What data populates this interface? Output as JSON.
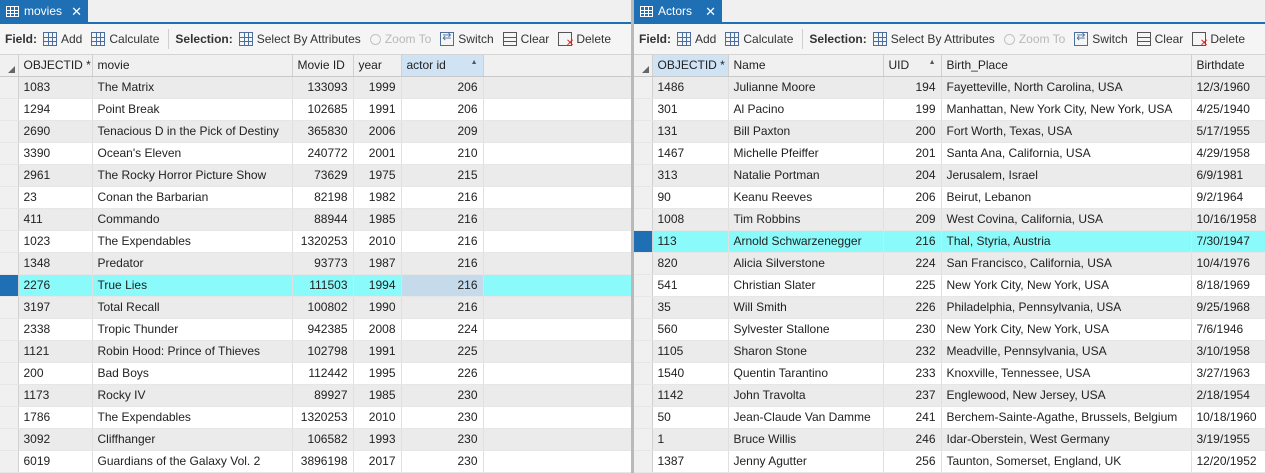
{
  "left": {
    "tab_title": "movies",
    "toolbar": {
      "field_label": "Field:",
      "add": "Add",
      "calculate": "Calculate",
      "selection_label": "Selection:",
      "select_by_attributes": "Select By Attributes",
      "zoom_to": "Zoom To",
      "switch": "Switch",
      "clear": "Clear",
      "delete": "Delete"
    },
    "columns": [
      "OBJECTID *",
      "movie",
      "Movie ID",
      "year",
      "actor id"
    ],
    "rows": [
      [
        "1083",
        "The Matrix",
        "133093",
        "1999",
        "206"
      ],
      [
        "1294",
        "Point Break",
        "102685",
        "1991",
        "206"
      ],
      [
        "2690",
        "Tenacious D in the Pick of Destiny",
        "365830",
        "2006",
        "209"
      ],
      [
        "3390",
        "Ocean's Eleven",
        "240772",
        "2001",
        "210"
      ],
      [
        "2961",
        "The Rocky Horror Picture Show",
        "73629",
        "1975",
        "215"
      ],
      [
        "23",
        "Conan the Barbarian",
        "82198",
        "1982",
        "216"
      ],
      [
        "411",
        "Commando",
        "88944",
        "1985",
        "216"
      ],
      [
        "1023",
        "The Expendables",
        "1320253",
        "2010",
        "216"
      ],
      [
        "1348",
        "Predator",
        "93773",
        "1987",
        "216"
      ],
      [
        "2276",
        "True Lies",
        "111503",
        "1994",
        "216"
      ],
      [
        "3197",
        "Total Recall",
        "100802",
        "1990",
        "216"
      ],
      [
        "2338",
        "Tropic Thunder",
        "942385",
        "2008",
        "224"
      ],
      [
        "1121",
        "Robin Hood: Prince of Thieves",
        "102798",
        "1991",
        "225"
      ],
      [
        "200",
        "Bad Boys",
        "112442",
        "1995",
        "226"
      ],
      [
        "1173",
        "Rocky IV",
        "89927",
        "1985",
        "230"
      ],
      [
        "1786",
        "The Expendables",
        "1320253",
        "2010",
        "230"
      ],
      [
        "3092",
        "Cliffhanger",
        "106582",
        "1993",
        "230"
      ],
      [
        "6019",
        "Guardians of the Galaxy Vol. 2",
        "3896198",
        "2017",
        "230"
      ]
    ]
  },
  "right": {
    "tab_title": "Actors",
    "toolbar": {
      "field_label": "Field:",
      "add": "Add",
      "calculate": "Calculate",
      "selection_label": "Selection:",
      "select_by_attributes": "Select By Attributes",
      "zoom_to": "Zoom To",
      "switch": "Switch",
      "clear": "Clear",
      "delete": "Delete"
    },
    "columns": [
      "OBJECTID *",
      "Name",
      "UID",
      "Birth_Place",
      "Birthdate"
    ],
    "rows": [
      [
        "1486",
        "Julianne Moore",
        "194",
        "Fayetteville, North Carolina, USA",
        "12/3/1960"
      ],
      [
        "301",
        "Al Pacino",
        "199",
        "Manhattan, New York City, New York, USA",
        "4/25/1940"
      ],
      [
        "131",
        "Bill Paxton",
        "200",
        "Fort Worth, Texas, USA",
        "5/17/1955"
      ],
      [
        "1467",
        "Michelle Pfeiffer",
        "201",
        "Santa Ana, California, USA",
        "4/29/1958"
      ],
      [
        "313",
        "Natalie Portman",
        "204",
        "Jerusalem, Israel",
        "6/9/1981"
      ],
      [
        "90",
        "Keanu Reeves",
        "206",
        "Beirut, Lebanon",
        "9/2/1964"
      ],
      [
        "1008",
        "Tim Robbins",
        "209",
        "West Covina, California, USA",
        "10/16/1958"
      ],
      [
        "113",
        "Arnold Schwarzenegger",
        "216",
        "Thal, Styria, Austria",
        "7/30/1947"
      ],
      [
        "820",
        "Alicia Silverstone",
        "224",
        "San Francisco, California, USA",
        "10/4/1976"
      ],
      [
        "541",
        "Christian Slater",
        "225",
        "New York City, New York, USA",
        "8/18/1969"
      ],
      [
        "35",
        "Will Smith",
        "226",
        "Philadelphia, Pennsylvania, USA",
        "9/25/1968"
      ],
      [
        "560",
        "Sylvester Stallone",
        "230",
        "New York City, New York, USA",
        "7/6/1946"
      ],
      [
        "1105",
        "Sharon Stone",
        "232",
        "Meadville, Pennsylvania, USA",
        "3/10/1958"
      ],
      [
        "1540",
        "Quentin Tarantino",
        "233",
        "Knoxville, Tennessee, USA",
        "3/27/1963"
      ],
      [
        "1142",
        "John Travolta",
        "237",
        "Englewood, New Jersey, USA",
        "2/18/1954"
      ],
      [
        "50",
        "Jean-Claude Van Damme",
        "241",
        "Berchem-Sainte-Agathe, Brussels, Belgium",
        "10/18/1960"
      ],
      [
        "1",
        "Bruce Willis",
        "246",
        "Idar-Oberstein, West Germany",
        "3/19/1955"
      ],
      [
        "1387",
        "Jenny Agutter",
        "256",
        "Taunton, Somerset, England, UK",
        "12/20/1952"
      ]
    ]
  },
  "colors": {
    "tab_blue": "#1e6fb4",
    "highlight": "#8afafa",
    "active_cell": "#c5dbec",
    "sorted_header": "#cfe3f5"
  },
  "icons": {
    "tab": "table-icon",
    "add": "add-field-icon",
    "calculate": "calculator-icon",
    "select": "select-by-attributes-icon",
    "zoom": "zoom-to-icon",
    "switch": "switch-icon",
    "clear": "clear-selection-icon",
    "delete": "delete-icon"
  }
}
